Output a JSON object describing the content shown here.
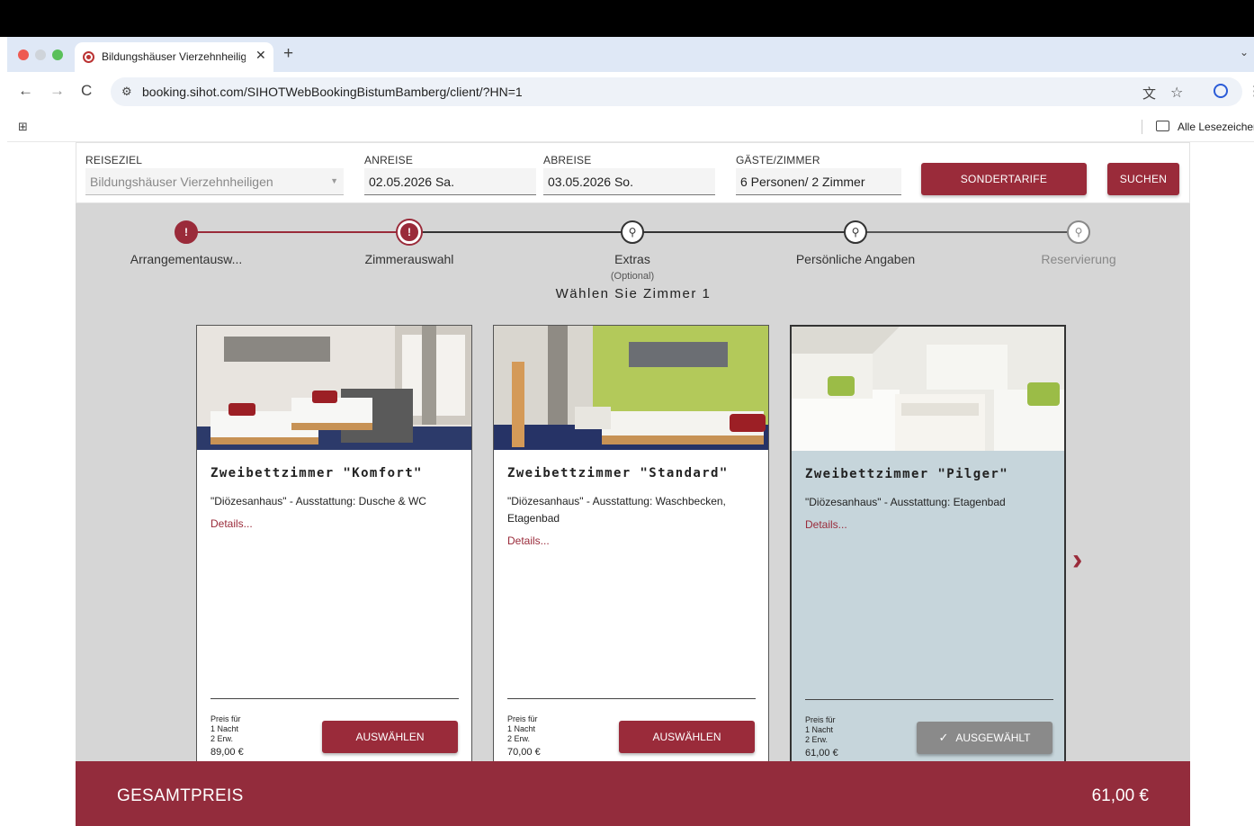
{
  "browser": {
    "tab_title": "Bildungshäuser Vierzehnheilig",
    "tab_close": "✕",
    "new_tab": "+",
    "url": "booking.sihot.com/SIHOTWebBookingBistumBamberg/client/?HN=1",
    "bookmarks_folder": "Alle Lesezeichen"
  },
  "search": {
    "reiseziel_label": "REISEZIEL",
    "reiseziel_value": "Bildungshäuser Vierzehnheiligen",
    "anreise_label": "ANREISE",
    "anreise_value": "02.05.2026 Sa.",
    "abreise_label": "ABREISE",
    "abreise_value": "03.05.2026 So.",
    "gaeste_label": "GÄSTE/ZIMMER",
    "gaeste_value": "6 Personen/ 2 Zimmer",
    "sondertarife_label": "SONDERTARIFE",
    "suchen_label": "SUCHEN"
  },
  "steps": [
    {
      "label": "Arrangementausw...",
      "sub": "",
      "state": "done"
    },
    {
      "label": "Zimmerauswahl",
      "sub": "",
      "state": "active"
    },
    {
      "label": "Extras",
      "sub": "(Optional)",
      "state": "todo"
    },
    {
      "label": "Persönliche Angaben",
      "sub": "",
      "state": "todo"
    },
    {
      "label": "Reservierung",
      "sub": "",
      "state": "disabled"
    }
  ],
  "section_heading": "Wählen Sie Zimmer 1",
  "rooms": [
    {
      "title": "Zweibettzimmer \"Komfort\"",
      "description": "\"Diözesanhaus\" - Ausstattung: Dusche & WC",
      "details": "Details...",
      "price_label": "Preis für\n1 Nacht\n2 Erw.",
      "price": "89,00 €",
      "button": "AUSWÄHLEN",
      "selected": false
    },
    {
      "title": "Zweibettzimmer \"Standard\"",
      "description": "\"Diözesanhaus\" - Ausstattung: Waschbecken, Etagenbad",
      "details": "Details...",
      "price_label": "Preis für\n1 Nacht\n2 Erw.",
      "price": "70,00 €",
      "button": "AUSWÄHLEN",
      "selected": false
    },
    {
      "title": "Zweibettzimmer \"Pilger\"",
      "description": "\"Diözesanhaus\" - Ausstattung: Etagenbad",
      "details": "Details...",
      "price_label": "Preis für\n1 Nacht\n2 Erw.",
      "price": "61,00 €",
      "button": "AUSGEWÄHLT",
      "selected": true
    }
  ],
  "total": {
    "label": "GESAMTPREIS",
    "value": "61,00 €"
  },
  "colors": {
    "brand": "#9a2b3a",
    "total_bar": "#932c3c",
    "selected_card": "#c6d5db",
    "page_bg": "#d6d6d6"
  },
  "icons": {
    "step_done": "alert-circle-icon",
    "step_todo": "location-pin-icon",
    "next": "chevron-right-icon",
    "selected": "check-icon"
  }
}
